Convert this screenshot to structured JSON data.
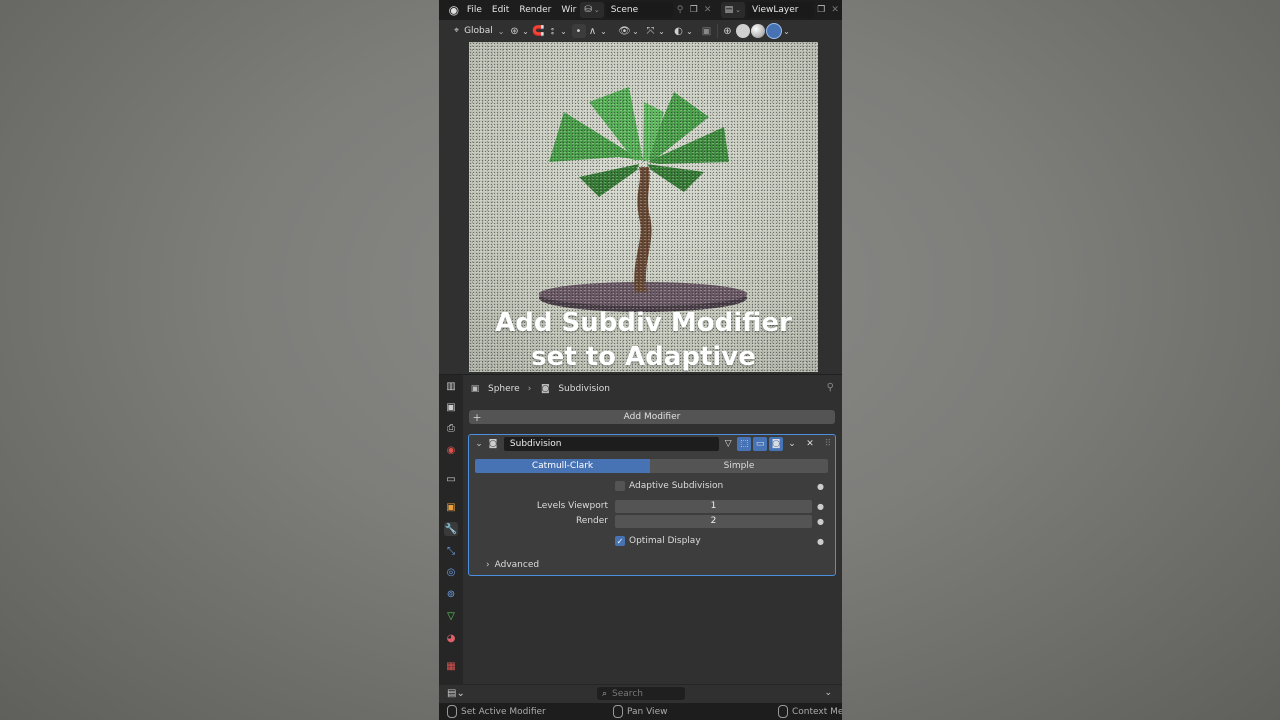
{
  "topbar": {
    "menus": [
      "File",
      "Edit",
      "Render",
      "Wir"
    ],
    "scene": "Scene",
    "view_layer": "ViewLayer"
  },
  "viewport_header": {
    "orientation": "Global"
  },
  "overlay_caption": {
    "line1": "Add Subdiv Modifier",
    "line2": "set to Adaptive"
  },
  "properties": {
    "breadcrumb": {
      "object": "Sphere",
      "modifier": "Subdivision"
    },
    "add_modifier_label": "Add Modifier",
    "modifier": {
      "name": "Subdivision",
      "type_options": [
        "Catmull-Clark",
        "Simple"
      ],
      "selected_type": "Catmull-Clark",
      "adaptive_label": "Adaptive Subdivision",
      "adaptive_checked": false,
      "levels_viewport_label": "Levels Viewport",
      "levels_viewport_value": "1",
      "render_label": "Render",
      "render_value": "2",
      "optimal_display_label": "Optimal Display",
      "optimal_display_checked": true,
      "advanced_label": "Advanced"
    }
  },
  "footer": {
    "search_placeholder": "Search"
  },
  "statusbar": {
    "left": "Set Active Modifier",
    "middle": "Pan View",
    "right": "Context Men"
  },
  "colors": {
    "accent_blue": "#4772b3",
    "panel_outline": "#4a8fe0"
  }
}
